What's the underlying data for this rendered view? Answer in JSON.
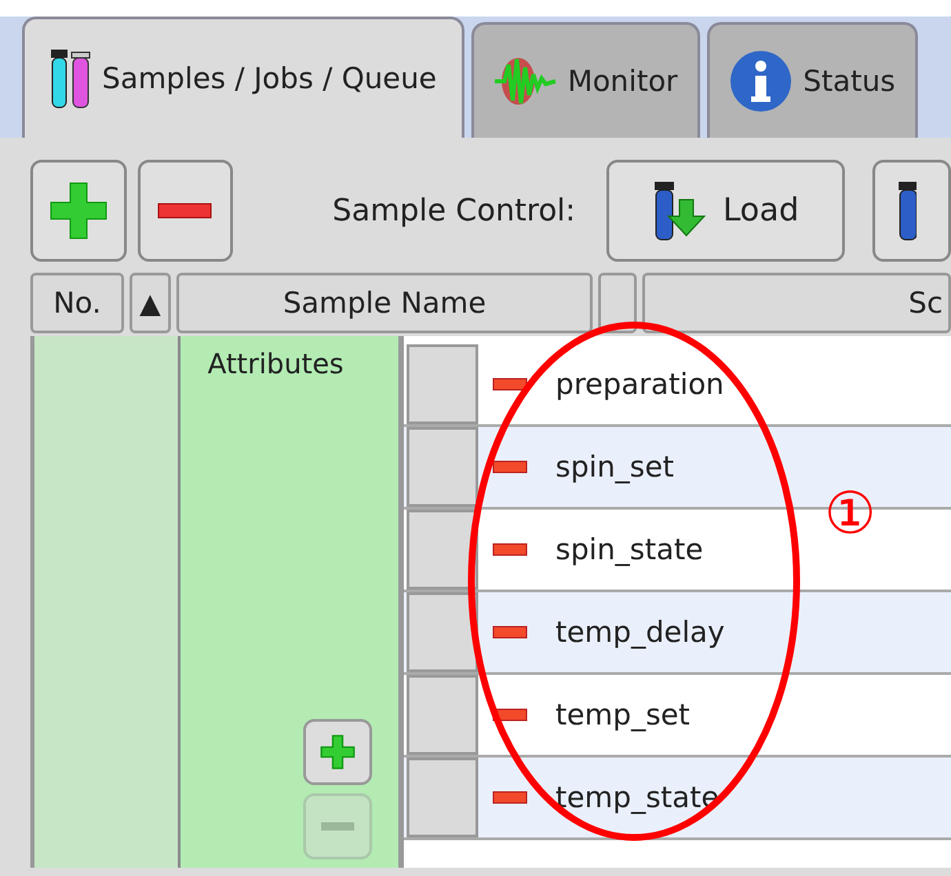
{
  "tabs": [
    {
      "label": "Samples / Jobs / Queue",
      "kind": "samples",
      "selected": true
    },
    {
      "label": "Monitor",
      "kind": "monitor",
      "selected": false
    },
    {
      "label": "Status",
      "kind": "status",
      "selected": false
    }
  ],
  "toolbar": {
    "control_label": "Sample Control:",
    "buttons": [
      {
        "label": "Load",
        "kind": "load"
      },
      {
        "kind": "cut"
      }
    ]
  },
  "table": {
    "columns": [
      {
        "label": "No."
      },
      {
        "label": "▲"
      },
      {
        "label": "Sample Name"
      },
      {},
      {
        "label": "Sc"
      }
    ],
    "attributes_label": "Attributes",
    "add_disabled": false,
    "remove_disabled": true,
    "attributes": [
      {
        "name": "preparation"
      },
      {
        "name": "spin_set"
      },
      {
        "name": "spin_state"
      },
      {
        "name": "temp_delay"
      },
      {
        "name": "temp_set"
      },
      {
        "name": "temp_state"
      }
    ]
  },
  "annotation": {
    "label": "①"
  }
}
